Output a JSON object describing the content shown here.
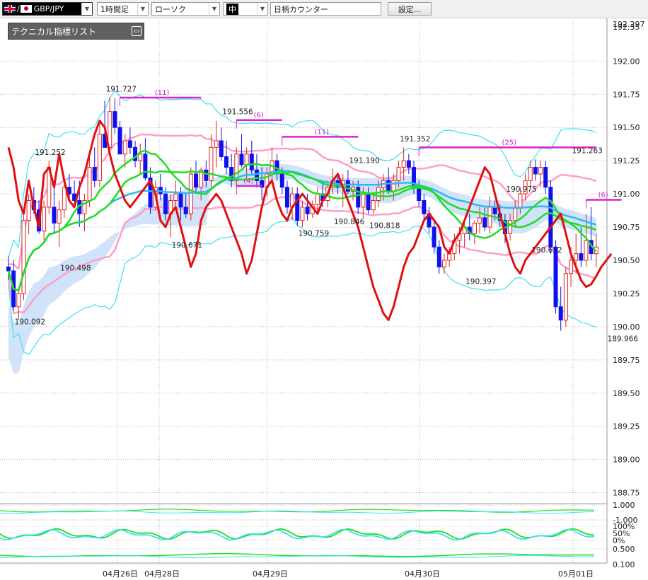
{
  "toolbar": {
    "pair_label": "GBP/JPY",
    "timeframe": "1時間足",
    "chart_type": "ローソク",
    "candle_size": "中",
    "counter_label": "日柄カウンター",
    "settings_label": "設定..."
  },
  "panel": {
    "title": "テクニカル指標リスト"
  },
  "colors": {
    "up_candle": "#e02020",
    "down_candle": "#1010ee",
    "bollinger": "#ff9ec8",
    "bollinger_outer": "#40e0f0",
    "ma_short": "#e01010",
    "ma_mid": "#20dd20",
    "ma_long": "#30b8f0",
    "cloud": "#c8def8",
    "cloud_bear": "#ffc8e0",
    "counter": "#e020d0"
  },
  "chart_data": {
    "type": "candlestick",
    "price_axis": {
      "ticks": [
        "192.00",
        "191.75",
        "191.50",
        "191.25",
        "191.00",
        "190.75",
        "190.50",
        "190.25",
        "190.00",
        "189.75",
        "189.50",
        "189.25",
        "189.00",
        "188.75"
      ],
      "ylim": [
        188.7,
        192.3
      ],
      "top_labels": [
        "192.297",
        "192.35"
      ]
    },
    "date_labels": [
      "04月26日",
      "04月28日",
      "04月29日",
      "04月30日",
      "05月01日"
    ],
    "annotations": [
      {
        "text": "191.727",
        "x": 22,
        "y": 191.727
      },
      {
        "text": "191.556",
        "x": 45,
        "y": 191.556
      },
      {
        "text": "191.252",
        "x": 8,
        "y": 191.252
      },
      {
        "text": "191.190",
        "x": 70,
        "y": 191.19
      },
      {
        "text": "191.352",
        "x": 80,
        "y": 191.352
      },
      {
        "text": "191.263",
        "x": 114,
        "y": 191.263
      },
      {
        "text": "190.975",
        "x": 101,
        "y": 190.975
      },
      {
        "text": "190.759",
        "x": 60,
        "y": 190.759
      },
      {
        "text": "190.846",
        "x": 67,
        "y": 190.846
      },
      {
        "text": "190.818",
        "x": 74,
        "y": 190.818
      },
      {
        "text": "190.671",
        "x": 35,
        "y": 190.671
      },
      {
        "text": "190.632",
        "x": 106,
        "y": 190.632
      },
      {
        "text": "190.498",
        "x": 13,
        "y": 190.498
      },
      {
        "text": "190.397",
        "x": 93,
        "y": 190.397
      },
      {
        "text": "190.092",
        "x": 4,
        "y": 190.092
      },
      {
        "text": "189.966",
        "x": 121,
        "y": 189.966
      }
    ],
    "counters": [
      {
        "label": "(11)",
        "x1": 22,
        "x2": 38,
        "y": 191.725
      },
      {
        "label": "(6)",
        "x1": 45,
        "x2": 54,
        "y": 191.556
      },
      {
        "label": "(11)",
        "x1": 54,
        "x2": 69,
        "y": 191.43
      },
      {
        "label": "(4)",
        "x1": 45,
        "x2": 50,
        "y": 191.06
      },
      {
        "label": "(25)",
        "x1": 81,
        "x2": 116,
        "y": 191.35
      },
      {
        "label": "(6)",
        "x1": 114,
        "x2": 121,
        "y": 190.955
      }
    ],
    "candles": [
      [
        190.45,
        190.53,
        190.35,
        190.42
      ],
      [
        190.42,
        190.5,
        190.12,
        190.15
      ],
      [
        190.15,
        190.3,
        190.05,
        190.25
      ],
      [
        190.25,
        190.85,
        190.2,
        190.8
      ],
      [
        190.8,
        191.0,
        190.7,
        190.95
      ],
      [
        190.95,
        191.05,
        190.85,
        190.88
      ],
      [
        190.88,
        190.95,
        190.7,
        190.72
      ],
      [
        190.72,
        190.95,
        190.65,
        190.9
      ],
      [
        190.9,
        191.25,
        190.85,
        191.2
      ],
      [
        190.9,
        191.1,
        190.7,
        190.78
      ],
      [
        190.78,
        190.95,
        190.6,
        190.88
      ],
      [
        190.88,
        191.1,
        190.82,
        191.05
      ],
      [
        191.05,
        191.15,
        190.95,
        191.0
      ],
      [
        191.0,
        191.1,
        190.9,
        190.95
      ],
      [
        190.95,
        191.1,
        190.75,
        190.85
      ],
      [
        190.85,
        191.0,
        190.72,
        190.95
      ],
      [
        190.95,
        191.3,
        190.9,
        191.2
      ],
      [
        191.2,
        191.35,
        191.05,
        191.1
      ],
      [
        191.1,
        191.55,
        191.05,
        191.45
      ],
      [
        191.45,
        191.7,
        191.35,
        191.35
      ],
      [
        191.35,
        191.73,
        191.3,
        191.62
      ],
      [
        191.62,
        191.72,
        191.45,
        191.5
      ],
      [
        191.5,
        191.55,
        191.35,
        191.3
      ],
      [
        191.3,
        191.45,
        191.2,
        191.4
      ],
      [
        191.4,
        191.5,
        191.3,
        191.35
      ],
      [
        191.35,
        191.4,
        191.2,
        191.25
      ],
      [
        191.25,
        191.38,
        191.15,
        191.3
      ],
      [
        191.3,
        191.42,
        191.1,
        191.12
      ],
      [
        191.12,
        191.2,
        190.85,
        190.9
      ],
      [
        190.9,
        191.1,
        190.88,
        191.05
      ],
      [
        191.05,
        191.15,
        190.95,
        191.0
      ],
      [
        191.0,
        191.05,
        190.8,
        190.85
      ],
      [
        190.85,
        191.0,
        190.67,
        190.95
      ],
      [
        190.95,
        191.1,
        190.88,
        191.0
      ],
      [
        191.0,
        191.05,
        190.8,
        190.9
      ],
      [
        190.9,
        191.0,
        190.82,
        190.85
      ],
      [
        190.85,
        191.2,
        190.8,
        191.15
      ],
      [
        191.15,
        191.25,
        191.0,
        191.05
      ],
      [
        191.05,
        191.2,
        190.95,
        191.18
      ],
      [
        191.18,
        191.25,
        191.05,
        191.1
      ],
      [
        191.1,
        191.45,
        191.05,
        191.35
      ],
      [
        191.35,
        191.55,
        191.2,
        191.4
      ],
      [
        191.4,
        191.5,
        191.25,
        191.28
      ],
      [
        191.28,
        191.4,
        191.15,
        191.2
      ],
      [
        191.2,
        191.3,
        191.05,
        191.1
      ],
      [
        191.1,
        191.35,
        191.05,
        191.3
      ],
      [
        191.3,
        191.45,
        191.2,
        191.22
      ],
      [
        191.22,
        191.35,
        191.1,
        191.3
      ],
      [
        191.3,
        191.4,
        191.15,
        191.18
      ],
      [
        191.18,
        191.3,
        191.05,
        191.1
      ],
      [
        191.1,
        191.2,
        190.95,
        191.05
      ],
      [
        191.05,
        191.2,
        190.98,
        191.15
      ],
      [
        191.15,
        191.35,
        191.1,
        191.25
      ],
      [
        191.25,
        191.3,
        191.1,
        191.15
      ],
      [
        191.15,
        191.2,
        191.0,
        191.05
      ],
      [
        191.05,
        191.1,
        190.85,
        190.9
      ],
      [
        190.9,
        191.05,
        190.8,
        191.0
      ],
      [
        191.0,
        191.05,
        190.76,
        190.8
      ],
      [
        190.8,
        190.95,
        190.75,
        190.9
      ],
      [
        190.9,
        191.0,
        190.8,
        190.85
      ],
      [
        190.85,
        190.95,
        190.82,
        190.92
      ],
      [
        190.92,
        191.05,
        190.85,
        191.0
      ],
      [
        191.0,
        191.1,
        190.9,
        190.95
      ],
      [
        190.95,
        191.1,
        190.9,
        191.05
      ],
      [
        191.05,
        191.19,
        191.0,
        191.1
      ],
      [
        191.1,
        191.15,
        191.0,
        191.05
      ],
      [
        191.05,
        191.15,
        190.9,
        191.1
      ],
      [
        191.1,
        191.18,
        191.0,
        191.02
      ],
      [
        191.02,
        191.1,
        190.95,
        191.05
      ],
      [
        191.05,
        191.1,
        190.85,
        190.9
      ],
      [
        190.9,
        191.05,
        190.82,
        191.0
      ],
      [
        191.0,
        191.05,
        190.85,
        190.88
      ],
      [
        190.88,
        191.0,
        190.85,
        190.95
      ],
      [
        190.95,
        191.1,
        190.9,
        191.05
      ],
      [
        191.05,
        191.15,
        190.95,
        191.1
      ],
      [
        191.1,
        191.2,
        191.0,
        191.02
      ],
      [
        191.02,
        191.15,
        190.95,
        191.1
      ],
      [
        191.1,
        191.25,
        191.05,
        191.2
      ],
      [
        191.2,
        191.35,
        191.1,
        191.25
      ],
      [
        191.25,
        191.3,
        191.15,
        191.2
      ],
      [
        191.2,
        191.25,
        191.0,
        191.05
      ],
      [
        191.05,
        191.1,
        190.9,
        190.95
      ],
      [
        190.95,
        191.0,
        190.8,
        190.85
      ],
      [
        190.85,
        190.9,
        190.7,
        190.75
      ],
      [
        190.75,
        190.8,
        190.55,
        190.6
      ],
      [
        190.6,
        190.65,
        190.4,
        190.45
      ],
      [
        190.45,
        190.55,
        190.4,
        190.5
      ],
      [
        190.5,
        190.6,
        190.45,
        190.55
      ],
      [
        190.55,
        190.7,
        190.5,
        190.65
      ],
      [
        190.65,
        190.75,
        190.55,
        190.7
      ],
      [
        190.7,
        190.8,
        190.6,
        190.75
      ],
      [
        190.75,
        190.85,
        190.65,
        190.7
      ],
      [
        190.7,
        190.8,
        190.62,
        190.78
      ],
      [
        190.78,
        190.9,
        190.7,
        190.82
      ],
      [
        190.82,
        190.9,
        190.72,
        190.75
      ],
      [
        190.75,
        190.98,
        190.7,
        190.9
      ],
      [
        190.9,
        190.95,
        190.8,
        190.85
      ],
      [
        190.85,
        190.92,
        190.75,
        190.8
      ],
      [
        190.8,
        190.85,
        190.63,
        190.7
      ],
      [
        190.7,
        190.85,
        190.65,
        190.8
      ],
      [
        190.8,
        190.95,
        190.75,
        190.9
      ],
      [
        190.9,
        191.05,
        190.85,
        191.0
      ],
      [
        191.0,
        191.15,
        190.95,
        191.1
      ],
      [
        191.1,
        191.25,
        191.05,
        191.2
      ],
      [
        191.2,
        191.26,
        191.1,
        191.15
      ],
      [
        191.15,
        191.25,
        191.05,
        191.2
      ],
      [
        191.2,
        191.25,
        191.0,
        191.05
      ],
      [
        191.05,
        191.1,
        190.55,
        190.6
      ],
      [
        190.6,
        190.65,
        190.1,
        190.15
      ],
      [
        190.15,
        190.3,
        189.97,
        190.05
      ],
      [
        190.05,
        190.45,
        190.0,
        190.4
      ],
      [
        190.4,
        190.6,
        190.3,
        190.5
      ],
      [
        190.5,
        190.7,
        190.4,
        190.55
      ],
      [
        190.55,
        190.75,
        190.45,
        190.5
      ],
      [
        190.5,
        190.85,
        190.45,
        190.65
      ],
      [
        190.65,
        190.9,
        190.5,
        190.55
      ],
      [
        190.55,
        190.7,
        190.45,
        190.6
      ]
    ],
    "lines": {
      "ma_short": [
        191.35,
        191.2,
        190.95,
        190.85,
        191.1,
        190.9,
        190.75,
        191.15,
        191.2,
        191.05,
        191.3,
        191.1,
        190.95,
        190.9,
        191.05,
        191.15,
        191.3,
        191.45,
        191.55,
        191.5,
        191.3,
        191.15,
        191.05,
        190.95,
        190.9,
        190.95,
        191.0,
        191.05,
        191.1,
        191.0,
        190.8,
        190.75,
        190.85,
        190.9,
        190.75,
        190.6,
        190.45,
        190.55,
        190.8,
        190.9,
        190.95,
        191.0,
        190.95,
        190.85,
        190.75,
        190.65,
        190.55,
        190.4,
        190.5,
        190.7,
        190.9,
        191.05,
        191.1,
        190.95,
        190.85,
        190.8,
        190.9,
        190.95,
        191.0,
        190.95,
        190.9,
        190.85,
        190.95,
        191.0,
        191.1,
        191.15,
        191.05,
        190.95,
        190.85,
        190.75,
        190.6,
        190.45,
        190.3,
        190.2,
        190.1,
        190.05,
        190.15,
        190.3,
        190.45,
        190.55,
        190.6,
        190.7,
        190.8,
        190.85,
        190.8,
        190.75,
        190.6,
        190.55,
        190.65,
        190.7,
        190.8,
        190.9,
        191.0,
        191.1,
        191.2,
        191.15,
        191.0,
        190.85,
        190.7,
        190.55,
        190.45,
        190.4,
        190.5,
        190.55,
        190.6,
        190.65,
        190.7,
        190.75,
        190.8,
        190.85,
        190.7,
        190.55,
        190.45,
        190.35,
        190.3,
        190.32,
        190.38,
        190.45,
        190.5,
        190.55
      ]
    }
  }
}
